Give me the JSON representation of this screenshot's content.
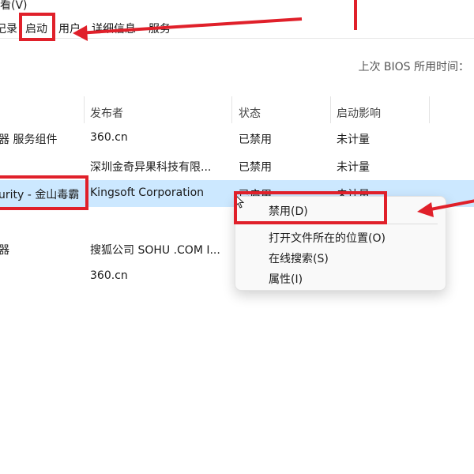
{
  "menubar": {
    "view_label": "看(V)"
  },
  "tabs": [
    "记录",
    "启动",
    "用户",
    "详细信息",
    "服务"
  ],
  "bios_label": "上次 BIOS 所用时间：",
  "columns": {
    "publisher": "发布者",
    "status": "状态",
    "impact": "启动影响"
  },
  "rows": [
    {
      "name": "器 服务组件",
      "publisher": "360.cn",
      "status": "已禁用",
      "impact": "未计量"
    },
    {
      "name": "",
      "publisher": "深圳金奇异果科技有限...",
      "status": "已禁用",
      "impact": "未计量"
    },
    {
      "name": "urity - 金山毒霸",
      "publisher": "Kingsoft Corporation",
      "status": "已启用",
      "impact": "未计量"
    },
    {
      "name": "",
      "publisher": "",
      "status": "",
      "impact": ""
    },
    {
      "name": "器",
      "publisher": "搜狐公司 SOHU .COM I...",
      "status": "",
      "impact": ""
    },
    {
      "name": "",
      "publisher": "360.cn",
      "status": "",
      "impact": ""
    }
  ],
  "context_menu": {
    "items": [
      "禁用(D)",
      "打开文件所在的位置(O)",
      "在线搜索(S)",
      "属性(I)"
    ]
  },
  "annotation_color": "#e0202a",
  "selection_color": "#cce8ff"
}
